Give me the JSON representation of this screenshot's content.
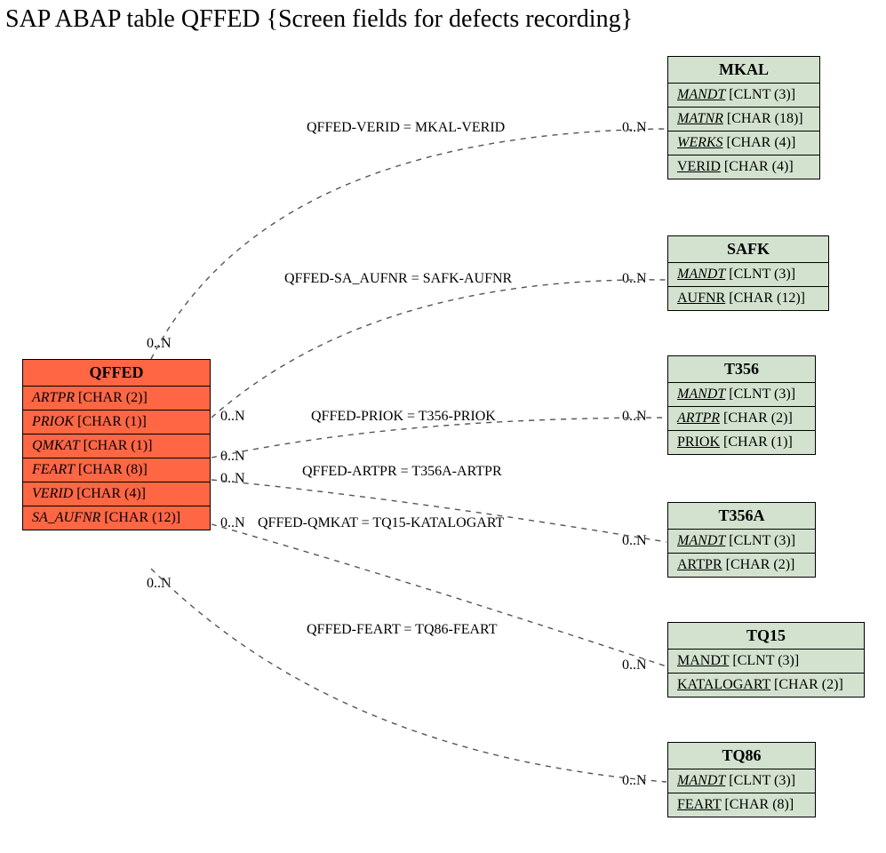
{
  "title": "SAP ABAP table QFFED {Screen fields for defects recording}",
  "main_table": {
    "name": "QFFED",
    "fields": [
      {
        "name": "ARTPR",
        "type": "[CHAR (2)]"
      },
      {
        "name": "PRIOK",
        "type": "[CHAR (1)]"
      },
      {
        "name": "QMKAT",
        "type": "[CHAR (1)]"
      },
      {
        "name": "FEART",
        "type": "[CHAR (8)]"
      },
      {
        "name": "VERID",
        "type": "[CHAR (4)]"
      },
      {
        "name": "SA_AUFNR",
        "type": "[CHAR (12)]"
      }
    ]
  },
  "targets": [
    {
      "name": "MKAL",
      "fields": [
        {
          "name": "MANDT",
          "type": "[CLNT (3)]",
          "u": true,
          "i": true
        },
        {
          "name": "MATNR",
          "type": "[CHAR (18)]",
          "u": true,
          "i": true
        },
        {
          "name": "WERKS",
          "type": "[CHAR (4)]",
          "u": true,
          "i": true
        },
        {
          "name": "VERID",
          "type": "[CHAR (4)]",
          "u": true
        }
      ]
    },
    {
      "name": "SAFK",
      "fields": [
        {
          "name": "MANDT",
          "type": "[CLNT (3)]",
          "u": true,
          "i": true
        },
        {
          "name": "AUFNR",
          "type": "[CHAR (12)]",
          "u": true
        }
      ]
    },
    {
      "name": "T356",
      "fields": [
        {
          "name": "MANDT",
          "type": "[CLNT (3)]",
          "u": true,
          "i": true
        },
        {
          "name": "ARTPR",
          "type": "[CHAR (2)]",
          "u": true,
          "i": true
        },
        {
          "name": "PRIOK",
          "type": "[CHAR (1)]",
          "u": true
        }
      ]
    },
    {
      "name": "T356A",
      "fields": [
        {
          "name": "MANDT",
          "type": "[CLNT (3)]",
          "u": true,
          "i": true
        },
        {
          "name": "ARTPR",
          "type": "[CHAR (2)]",
          "u": true
        }
      ]
    },
    {
      "name": "TQ15",
      "fields": [
        {
          "name": "MANDT",
          "type": "[CLNT (3)]",
          "u": true
        },
        {
          "name": "KATALOGART",
          "type": "[CHAR (2)]",
          "u": true
        }
      ]
    },
    {
      "name": "TQ86",
      "fields": [
        {
          "name": "MANDT",
          "type": "[CLNT (3)]",
          "u": true,
          "i": true
        },
        {
          "name": "FEART",
          "type": "[CHAR (8)]",
          "u": true
        }
      ]
    }
  ],
  "relations": [
    {
      "label": "QFFED-VERID = MKAL-VERID"
    },
    {
      "label": "QFFED-SA_AUFNR = SAFK-AUFNR"
    },
    {
      "label": "QFFED-PRIOK = T356-PRIOK"
    },
    {
      "label": "QFFED-ARTPR = T356A-ARTPR"
    },
    {
      "label": "QFFED-QMKAT = TQ15-KATALOGART"
    },
    {
      "label": "QFFED-FEART = TQ86-FEART"
    }
  ],
  "left_cards": [
    "0..N",
    "0..N",
    "0..N",
    "0..N",
    "0..N",
    "0..N"
  ],
  "right_cards": [
    "0..N",
    "0..N",
    "0..N",
    "0..N",
    "0..N",
    "0..N"
  ]
}
